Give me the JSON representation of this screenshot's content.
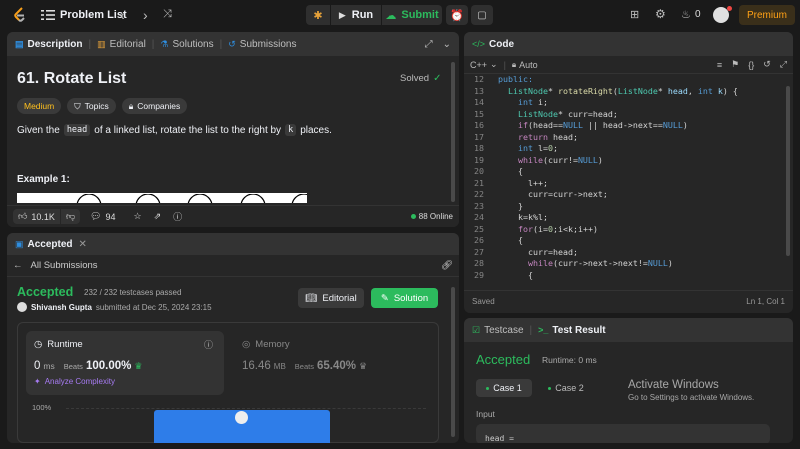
{
  "topbar": {
    "problem_list": "Problem List",
    "run": "Run",
    "submit": "Submit",
    "streak": "0",
    "premium": "Premium"
  },
  "desc_panel": {
    "tabs": [
      "Description",
      "Editorial",
      "Solutions",
      "Submissions"
    ],
    "title": "61. Rotate List",
    "status": "Solved",
    "difficulty": "Medium",
    "topics": "Topics",
    "companies": "Companies",
    "text_a": "Given the",
    "code_head": "head",
    "text_b": "of a linked list, rotate the list to the right by",
    "code_k": "k",
    "text_c": "places.",
    "example": "Example 1:",
    "likes": "10.1K",
    "comments": "94",
    "online": "88 Online"
  },
  "accepted_panel": {
    "tab": "Accepted",
    "back": "All Submissions",
    "status": "Accepted",
    "testcases": "232 / 232 testcases passed",
    "user": "Shivansh Gupta",
    "submitted": "submitted at Dec 25, 2024 23:15",
    "editorial": "Editorial",
    "solution": "Solution",
    "runtime_label": "Runtime",
    "runtime_value": "0",
    "runtime_unit": "ms",
    "beats_label": "Beats",
    "runtime_beats": "100.00%",
    "analyze": "Analyze Complexity",
    "memory_label": "Memory",
    "memory_value": "16.46",
    "memory_unit": "MB",
    "memory_beats": "65.40%",
    "chart_tick": "100%"
  },
  "chart_data": {
    "type": "bar",
    "values": [
      100
    ],
    "ylim": [
      0,
      100
    ],
    "tick": "100%"
  },
  "code_panel": {
    "tab": "Code",
    "language": "C++",
    "auto": "Auto",
    "saved": "Saved",
    "position": "Ln 1, Col 1"
  },
  "code_lines": [
    {
      "n": "12",
      "indent": 0,
      "tokens": [
        [
          "kw",
          "public:"
        ]
      ]
    },
    {
      "n": "13",
      "indent": 1,
      "tokens": [
        [
          "ty",
          "ListNode"
        ],
        [
          "tx",
          "* "
        ],
        [
          "fn",
          "rotateRight"
        ],
        [
          "tx",
          "("
        ],
        [
          "ty",
          "ListNode"
        ],
        [
          "tx",
          "* "
        ],
        [
          "pl",
          "head"
        ],
        [
          "tx",
          ", "
        ],
        [
          "kw",
          "int"
        ],
        [
          "tx",
          " "
        ],
        [
          "pl",
          "k"
        ],
        [
          "tx",
          ") {"
        ]
      ]
    },
    {
      "n": "14",
      "indent": 2,
      "tokens": [
        [
          "kw",
          "int"
        ],
        [
          "tx",
          " i;"
        ]
      ]
    },
    {
      "n": "15",
      "indent": 2,
      "tokens": [
        [
          "ty",
          "ListNode"
        ],
        [
          "tx",
          "* curr=head;"
        ]
      ]
    },
    {
      "n": "16",
      "indent": 2,
      "tokens": [
        [
          "pk",
          "if"
        ],
        [
          "tx",
          "(head=="
        ],
        [
          "kw",
          "NULL"
        ],
        [
          "tx",
          " || head->next=="
        ],
        [
          "kw",
          "NULL"
        ],
        [
          "tx",
          ")"
        ]
      ]
    },
    {
      "n": "17",
      "indent": 2,
      "tokens": [
        [
          "pk",
          "return"
        ],
        [
          "tx",
          " head;"
        ]
      ]
    },
    {
      "n": "18",
      "indent": 2,
      "tokens": [
        [
          "kw",
          "int"
        ],
        [
          "tx",
          " l="
        ],
        [
          "nm",
          "0"
        ],
        [
          "tx",
          ";"
        ]
      ]
    },
    {
      "n": "19",
      "indent": 2,
      "tokens": [
        [
          "pk",
          "while"
        ],
        [
          "tx",
          "(curr!="
        ],
        [
          "kw",
          "NULL"
        ],
        [
          "tx",
          ")"
        ]
      ]
    },
    {
      "n": "20",
      "indent": 2,
      "tokens": [
        [
          "tx",
          "{"
        ]
      ]
    },
    {
      "n": "21",
      "indent": 3,
      "tokens": [
        [
          "tx",
          "l++;"
        ]
      ]
    },
    {
      "n": "22",
      "indent": 3,
      "tokens": [
        [
          "tx",
          "curr=curr->next;"
        ]
      ]
    },
    {
      "n": "23",
      "indent": 2,
      "tokens": [
        [
          "tx",
          "}"
        ]
      ]
    },
    {
      "n": "24",
      "indent": 2,
      "tokens": [
        [
          "tx",
          "k=k%l;"
        ]
      ]
    },
    {
      "n": "25",
      "indent": 2,
      "tokens": [
        [
          "pk",
          "for"
        ],
        [
          "tx",
          "(i="
        ],
        [
          "nm",
          "0"
        ],
        [
          "tx",
          ";i<k;i++)"
        ]
      ]
    },
    {
      "n": "26",
      "indent": 2,
      "tokens": [
        [
          "tx",
          "{"
        ]
      ]
    },
    {
      "n": "27",
      "indent": 3,
      "tokens": [
        [
          "tx",
          "curr=head;"
        ]
      ]
    },
    {
      "n": "28",
      "indent": 3,
      "tokens": [
        [
          "pk",
          "while"
        ],
        [
          "tx",
          "(curr->next->next!="
        ],
        [
          "kw",
          "NULL"
        ],
        [
          "tx",
          ")"
        ]
      ]
    },
    {
      "n": "29",
      "indent": 3,
      "tokens": [
        [
          "tx",
          "{"
        ]
      ]
    }
  ],
  "test_panel": {
    "tab_testcase": "Testcase",
    "tab_result": "Test Result",
    "status": "Accepted",
    "runtime": "Runtime: 0 ms",
    "case1": "Case 1",
    "case2": "Case 2",
    "input_label": "Input",
    "input_value": "head =",
    "watermark_title": "Activate Windows",
    "watermark_sub": "Go to Settings to activate Windows."
  }
}
